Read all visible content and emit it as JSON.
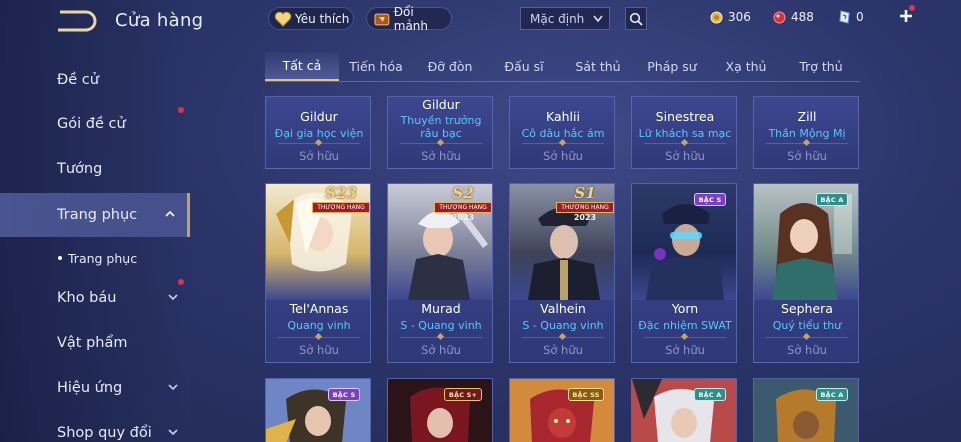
{
  "header": {
    "title": "Cửa hàng"
  },
  "sidebar": {
    "items": [
      {
        "label": "Đề cử"
      },
      {
        "label": "Gói đề cử"
      },
      {
        "label": "Tướng"
      },
      {
        "label": "Trang phục"
      },
      {
        "label": "Trang phục"
      },
      {
        "label": "Kho báu"
      },
      {
        "label": "Vật phẩm"
      },
      {
        "label": "Hiệu ứng"
      },
      {
        "label": "Shop quy đổi"
      }
    ]
  },
  "topbar": {
    "favorite_label": "Yêu thích",
    "exchange_label": "Đổi mảnh",
    "sort_value": "Mặc định",
    "currencies": {
      "gold": "306",
      "gems": "488",
      "vouchers": "0"
    }
  },
  "tabs": [
    "Tất cả",
    "Tiến hóa",
    "Đỡ đòn",
    "Đấu sĩ",
    "Sát thủ",
    "Pháp sư",
    "Xạ thủ",
    "Trợ thủ"
  ],
  "cards_row1": [
    {
      "hero": "Gildur",
      "skin": "Đại gia học viện",
      "status": "Sở hữu"
    },
    {
      "hero": "Gildur",
      "skin": "Thuyền trưởng râu bạc",
      "status": "Sở hữu"
    },
    {
      "hero": "Kahlii",
      "skin": "Cô dâu hắc ám",
      "status": "Sở hữu"
    },
    {
      "hero": "Sinestrea",
      "skin": "Lữ khách sa mạc",
      "status": "Sở hữu"
    },
    {
      "hero": "Zill",
      "skin": "Thần Mộng Mị",
      "status": "Sở hữu"
    }
  ],
  "cards_row2": [
    {
      "hero": "Tel'Annas",
      "skin": "Quang vinh",
      "status": "Sở hữu",
      "season": "S23",
      "rank": "THƯỢNG HẠNG",
      "year": ""
    },
    {
      "hero": "Murad",
      "skin": "S - Quang vinh",
      "status": "Sở hữu",
      "season": "S2",
      "rank": "THƯỢNG HẠNG",
      "year": "2023"
    },
    {
      "hero": "Valhein",
      "skin": "S - Quang vinh",
      "status": "Sở hữu",
      "season": "S1",
      "rank": "THƯỢNG HẠNG",
      "year": "2023"
    },
    {
      "hero": "Yorn",
      "skin": "Đặc nhiệm SWAT",
      "status": "Sở hữu",
      "badge": "BẬC S"
    },
    {
      "hero": "Sephera",
      "skin": "Quý tiểu thư",
      "status": "Sở hữu",
      "badge": "BẬC A"
    }
  ],
  "cards_row3_badges": [
    "BẬC S",
    "BẬC S+",
    "BẬC SS",
    "BẬC A",
    "BẬC A"
  ],
  "colors": {
    "accent_gold": "#e0c27a",
    "skin_name_blue": "#58c7ff",
    "notification_red": "#e0334a"
  }
}
